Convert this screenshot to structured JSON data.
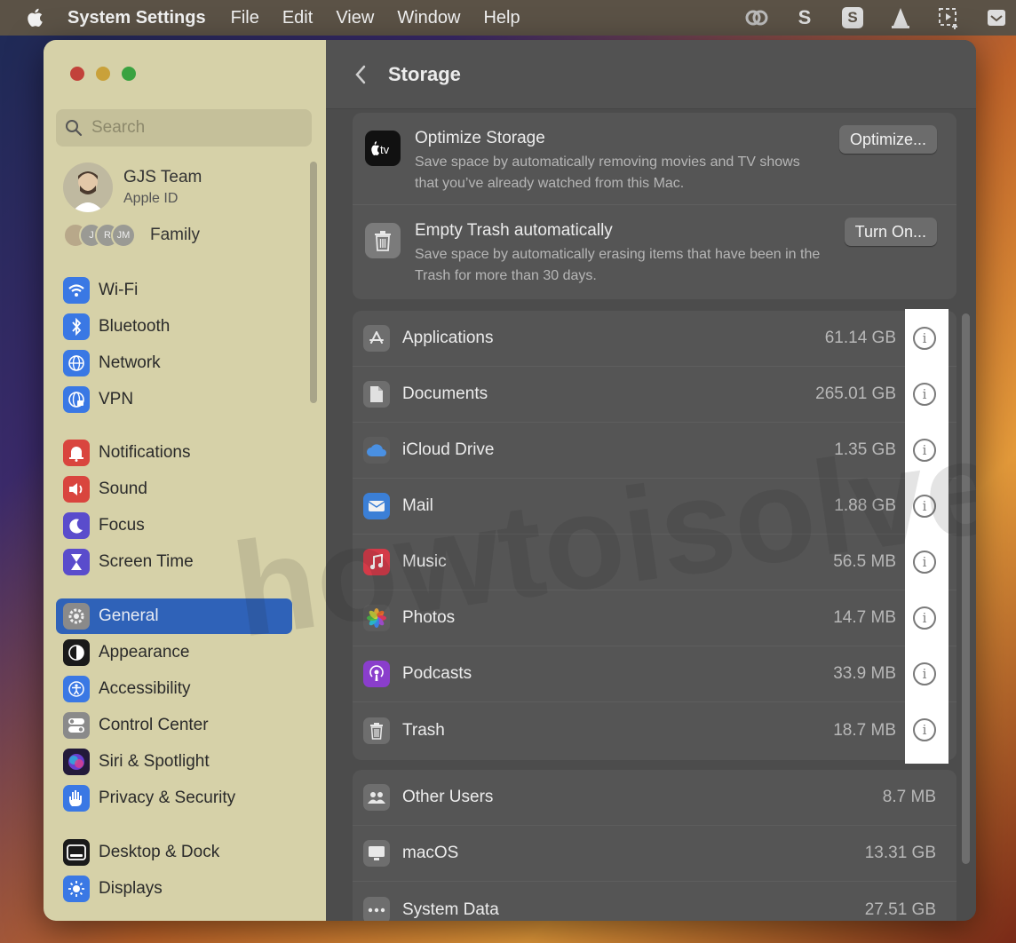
{
  "menubar": {
    "app_name": "System Settings",
    "menus": [
      "File",
      "Edit",
      "View",
      "Window",
      "Help"
    ],
    "status_icons": [
      "creative-cloud-icon",
      "s-logo-icon",
      "s-box-icon",
      "vlc-icon",
      "screenshot-icon",
      "stack-icon"
    ]
  },
  "sidebar": {
    "search_placeholder": "Search",
    "profile": {
      "name": "GJS Team",
      "subtitle": "Apple ID"
    },
    "family": {
      "label": "Family",
      "initials": [
        "J",
        "R",
        "JM"
      ]
    },
    "items": [
      {
        "label": "Wi-Fi",
        "icon": "wifi-icon",
        "color": "#3a78e4"
      },
      {
        "label": "Bluetooth",
        "icon": "bluetooth-icon",
        "color": "#3a78e4"
      },
      {
        "label": "Network",
        "icon": "globe-icon",
        "color": "#3a78e4"
      },
      {
        "label": "VPN",
        "icon": "vpn-globe-icon",
        "color": "#3a78e4"
      },
      {
        "label": "Notifications",
        "icon": "bell-icon",
        "color": "#d9453e"
      },
      {
        "label": "Sound",
        "icon": "speaker-icon",
        "color": "#d9453e"
      },
      {
        "label": "Focus",
        "icon": "moon-icon",
        "color": "#5a4ccc"
      },
      {
        "label": "Screen Time",
        "icon": "hourglass-icon",
        "color": "#5a4ccc"
      },
      {
        "label": "General",
        "icon": "gear-icon",
        "color": "#8a8a8a",
        "selected": true
      },
      {
        "label": "Appearance",
        "icon": "appearance-icon",
        "color": "#1a1a1a"
      },
      {
        "label": "Accessibility",
        "icon": "accessibility-icon",
        "color": "#3a78e4"
      },
      {
        "label": "Control Center",
        "icon": "toggles-icon",
        "color": "#8a8a8a"
      },
      {
        "label": "Siri & Spotlight",
        "icon": "siri-icon",
        "color": "#6a3fd0"
      },
      {
        "label": "Privacy & Security",
        "icon": "hand-icon",
        "color": "#3a78e4"
      },
      {
        "label": "Desktop & Dock",
        "icon": "dock-icon",
        "color": "#1a1a1a"
      },
      {
        "label": "Displays",
        "icon": "sun-icon",
        "color": "#3a78e4"
      }
    ]
  },
  "main": {
    "title": "Storage",
    "recommendations": [
      {
        "title": "Optimize Storage",
        "description": "Save space by automatically removing movies and TV shows that you’ve already watched from this Mac.",
        "button": "Optimize...",
        "icon": "apple-tv-icon"
      },
      {
        "title": "Empty Trash automatically",
        "description": "Save space by automatically erasing items that have been in the Trash for more than 30 days.",
        "button": "Turn On...",
        "icon": "trash-icon"
      }
    ],
    "categories": [
      {
        "name": "Applications",
        "size": "61.14 GB",
        "icon": "app-store-icon"
      },
      {
        "name": "Documents",
        "size": "265.01 GB",
        "icon": "document-icon"
      },
      {
        "name": "iCloud Drive",
        "size": "1.35 GB",
        "icon": "icloud-icon"
      },
      {
        "name": "Mail",
        "size": "1.88 GB",
        "icon": "mail-icon"
      },
      {
        "name": "Music",
        "size": "56.5 MB",
        "icon": "music-icon"
      },
      {
        "name": "Photos",
        "size": "14.7 MB",
        "icon": "photos-icon"
      },
      {
        "name": "Podcasts",
        "size": "33.9 MB",
        "icon": "podcasts-icon"
      },
      {
        "name": "Trash",
        "size": "18.7 MB",
        "icon": "trash-icon"
      }
    ],
    "system": [
      {
        "name": "Other Users",
        "size": "8.7 MB",
        "icon": "users-icon"
      },
      {
        "name": "macOS",
        "size": "13.31 GB",
        "icon": "monitor-icon"
      },
      {
        "name": "System Data",
        "size": "27.51 GB",
        "icon": "ellipsis-icon"
      }
    ]
  },
  "watermark": "howtoisolve.com"
}
